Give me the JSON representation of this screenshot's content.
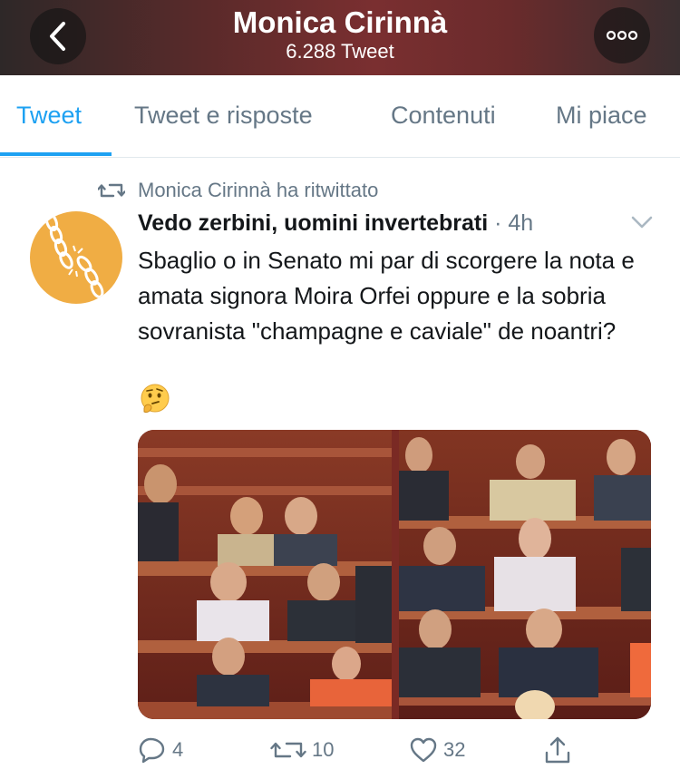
{
  "header": {
    "title": "Monica Cirinnà",
    "subtitle": "6.288 Tweet",
    "back_icon": "chevron-left-icon",
    "more_icon": "ellipsis-icon"
  },
  "tabs": [
    {
      "label": "Tweet",
      "active": true
    },
    {
      "label": "Tweet e risposte",
      "active": false
    },
    {
      "label": "Contenuti",
      "active": false
    },
    {
      "label": "Mi piace",
      "active": false
    }
  ],
  "tweet": {
    "retweeted_by": "Monica Cirinnà ha ritwittato",
    "author_name": "Vedo zerbini, uomini invertebrati",
    "time": " · 4h",
    "text": "Sbaglio o in Senato mi par di scorgere la nota e amata signora Moira Orfei oppure e la sobria  sovranista \"champagne e caviale\" de noantri?",
    "emoji": "thinking-face",
    "actions": {
      "replies": "4",
      "retweets": "10",
      "likes": "32"
    }
  },
  "colors": {
    "accent": "#1da1f2",
    "muted": "#657786",
    "avatar_bg": "#f0ad44"
  }
}
